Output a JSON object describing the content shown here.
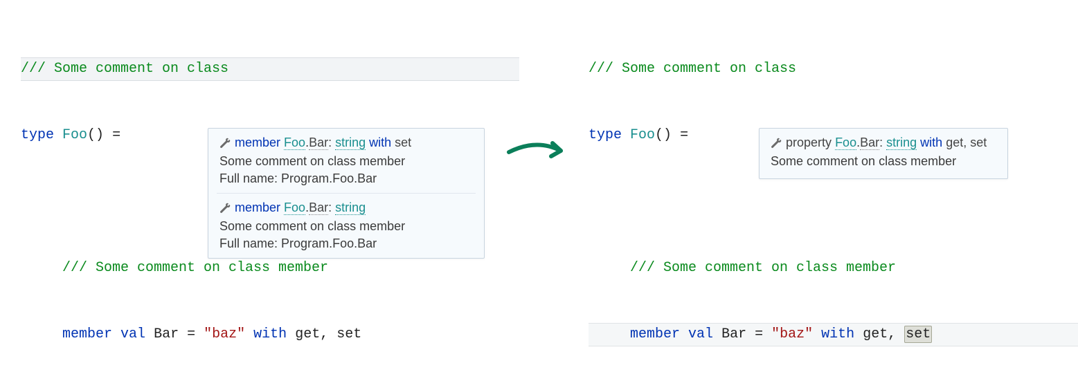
{
  "left": {
    "code": {
      "comment1": "/// Some comment on class",
      "kw_type": "type",
      "type_name": "Foo",
      "parens": "()",
      "eq": " =",
      "comment2": "/// Some comment on class member",
      "kw_member": "member",
      "kw_val": "val",
      "prop": "Bar",
      "eq2": " = ",
      "str_open": "\"",
      "str_val": "baz",
      "str_close": "\"",
      "kw_with": "with",
      "get": "get",
      "comma": ", ",
      "set": "set"
    },
    "tooltip": {
      "sections": [
        {
          "kw": "member",
          "type": "Foo",
          "dot": ".",
          "member": "Bar",
          "colon": ": ",
          "ret": "string",
          "withkw": "with",
          "rest": " set",
          "desc": "Some comment on class member",
          "full_label": "Full name:",
          "full_val": " Program.Foo.Bar"
        },
        {
          "kw": "member",
          "type": "Foo",
          "dot": ".",
          "member": "Bar",
          "colon": ": ",
          "ret": "string",
          "desc": "Some comment on class member",
          "full_label": "Full name:",
          "full_val": " Program.Foo.Bar"
        }
      ]
    }
  },
  "right": {
    "code": {
      "comment1": "/// Some comment on class",
      "kw_type": "type",
      "type_name": "Foo",
      "parens": "()",
      "eq": " =",
      "comment2": "/// Some comment on class member",
      "kw_member": "member",
      "kw_val": "val",
      "prop": "Bar",
      "eq2": " = ",
      "str_open": "\"",
      "str_val": "baz",
      "str_close": "\"",
      "kw_with": "with",
      "get": "get",
      "comma": ", ",
      "set": "set"
    },
    "tooltip": {
      "kw": "property",
      "type": "Foo",
      "dot": ".",
      "member": "Bar",
      "colon": ": ",
      "ret": "string",
      "withkw": "with",
      "rest": " get, set",
      "desc": "Some comment on class member"
    }
  },
  "icons": {
    "wrench": "wrench-icon"
  }
}
